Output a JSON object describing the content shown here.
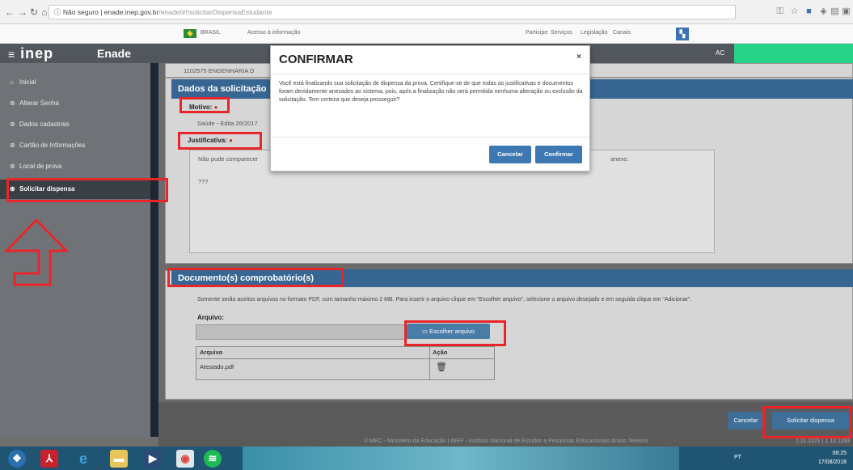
{
  "browser": {
    "url_secure": "Não seguro",
    "url_host": "enade.inep.gov.br",
    "url_path": "/enade/#!/solicitarDispensaEstudante"
  },
  "govbar": {
    "brasil": "BRASIL",
    "access": "Acesso à informação",
    "links": [
      "Participe",
      "Serviços",
      "Legislação",
      "Canais"
    ]
  },
  "header": {
    "logo": "inep",
    "brand": "Enade",
    "account": "AC"
  },
  "sidebar": {
    "items": [
      {
        "label": "Inicial"
      },
      {
        "label": "Alterar Senha"
      },
      {
        "label": "Dados cadastrais"
      },
      {
        "label": "Cartão de Informações"
      },
      {
        "label": "Local de prova"
      },
      {
        "label": "Solicitar dispensa"
      }
    ]
  },
  "main": {
    "top_text": "1102575 ENGENHARIA D",
    "section1_title": "Dados da solicitação",
    "motivo_label": "Motivo:",
    "motivo_value": "Saúde - Edita 26/2017",
    "justificativa_label": "Justificativa:",
    "justificativa_text": "Não pude comparecer",
    "justificativa_tail": "anexo.",
    "justificativa_extra": "???",
    "section2_title": "Documento(s) comprobatório(s)",
    "docs_desc": "Somente serão aceitos arquivos no formato PDF, com tamanho máximo 2 MB. Para inserir o arquivo clique em \"Escolher arquivo\", selecione o arquivo desejado e em seguida clique em \"Adicionar\".",
    "arquivo_label": "Arquivo:",
    "choose_button": "Escolher arquivo",
    "table_headers": [
      "Arquivo",
      "Ação"
    ],
    "table_rows": [
      {
        "file": "Atestado.pdf"
      }
    ],
    "cancel_button": "Cancelar",
    "submit_button": "Solicitar dispensa"
  },
  "modal": {
    "title": "CONFIRMAR",
    "close": "×",
    "body": "Você está finalizando sua solicitação de dispensa da prova. Certifique-se de que todas as justificativas e documentos foram devidamente anexados ao sistema, pois, após a finalização não será permitida nenhuma alteração ou exclusão da solicitação. Tem certeza que deseja prosseguir?",
    "cancel": "Cancelar",
    "confirm": "Confirmar"
  },
  "footer": {
    "text": "© MEC - Ministério da Educação | INEP - Instituto Nacional de Estudos e Pesquisas Educacionais Anísio Teixeira",
    "version": "1.11.1221 | 1.12.1193"
  },
  "taskbar": {
    "lang": "PT",
    "time": "08:25",
    "date": "17/08/2018"
  }
}
